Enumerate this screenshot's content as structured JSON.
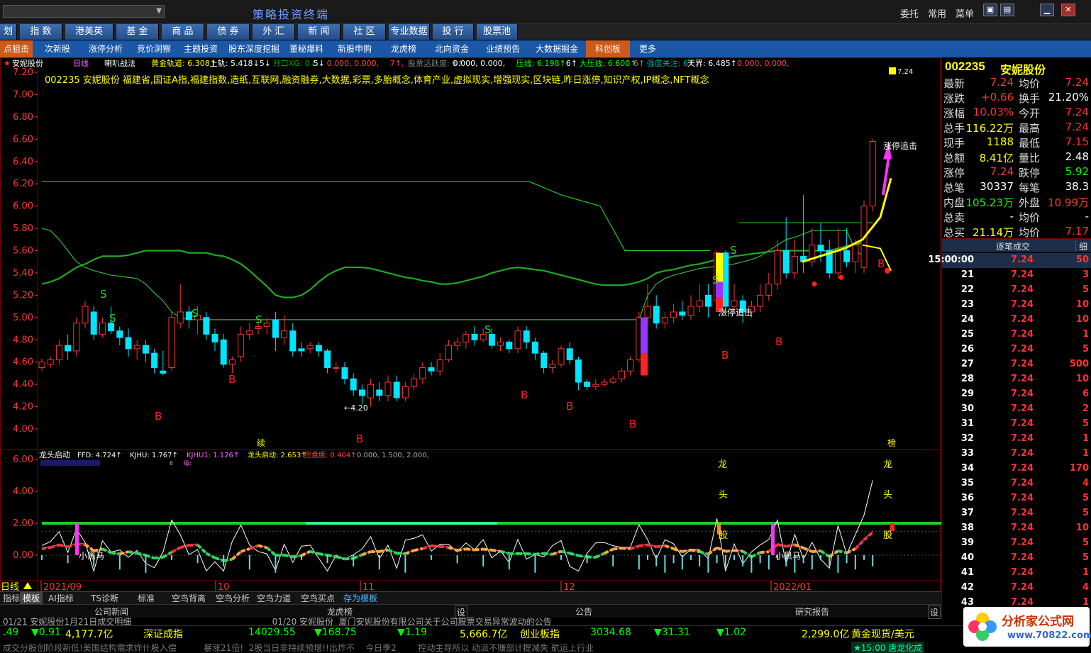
{
  "top": {
    "title": "策略投资终端",
    "links": [
      "委托",
      "常用",
      "菜单"
    ],
    "window_btns": [
      "▣",
      "▤",
      "▁",
      "✕"
    ]
  },
  "menu1": [
    "划板",
    "指 数",
    "港美英",
    "基 金",
    "商 品",
    "债 券",
    "外 汇",
    "新 闻",
    "社 区",
    "专业数据",
    "投 行",
    "股票池"
  ],
  "menu2": [
    "点狙击",
    "次新股",
    "涨停分析",
    "竞价洞察",
    "主题投资",
    "股东深度挖掘",
    "董秘爆料",
    "新股申购",
    "龙虎榜",
    "北向资金",
    "业绩预告",
    "大数据掘金",
    "科创板",
    "更多"
  ],
  "menu2_highlight": [
    0,
    12
  ],
  "chart": {
    "header": {
      "code_name": "安妮股份",
      "period": "日线",
      "indicator": "喇叭战法",
      "items": [
        {
          "t": "黄金轨道: 6.308↑",
          "c": "#ffff00"
        },
        {
          "t": "上轨: 5.418↓",
          "c": "#ffffff"
        },
        {
          "t": "5↓",
          "c": "#ffffff"
        },
        {
          "t": "开口XG: 0↓",
          "c": "#00aa00"
        },
        {
          "t": "5↓",
          "c": "#ffffff"
        },
        {
          "t": "0.000, 0.000,",
          "c": "#ff4444"
        },
        {
          "t": "7↑,",
          "c": "#ff4444"
        },
        {
          "t": "股票活跃度: 6↑",
          "c": "#888888"
        },
        {
          "t": "0.000, 0.000,",
          "c": "#ffffff"
        },
        {
          "t": "压线: 6.198↑",
          "c": "#00ff00"
        },
        {
          "t": "6↑",
          "c": "#ffffff"
        },
        {
          "t": "大压线: 6.600↑",
          "c": "#00ff00"
        },
        {
          "t": "6↑",
          "c": "#888888"
        },
        {
          "t": "强度关注: 6↑",
          "c": "#00aaaa"
        },
        {
          "t": "天界: 6.485↑",
          "c": "#ffffff"
        },
        {
          "t": "0.000, 0.000,",
          "c": "#ff4444"
        }
      ]
    },
    "concepts": "002235 安妮股份 福建省,国证A指,福建指数,造纸,互联网,融资融券,大数据,彩票,多胎概念,体育产业,虚拟现实,增强现实,区块链,昨日涨停,知识产权,IP概念,NFT概念",
    "price_ticks": [
      "7.20",
      "7.00",
      "6.80",
      "6.60",
      "6.40",
      "6.20",
      "6.00",
      "5.80",
      "5.60",
      "5.40",
      "5.20",
      "5.00",
      "4.80",
      "4.60",
      "4.40",
      "4.20",
      "4.00"
    ],
    "low_label": "←4.20",
    "tag_top": "7.24",
    "labels": {
      "zhangting": "涨停追击",
      "s": "S",
      "b": "B",
      "xu": "续",
      "bang": "榜",
      "long": "龙",
      "tou": "头",
      "gu": "股",
      "xiaoheima": "小黑马"
    },
    "sub": {
      "title": "龙头启动",
      "items": [
        {
          "t": "FFD: 4.724↑",
          "c": "#ffffff"
        },
        {
          "t": "KJHU: 1.767↑",
          "c": "#ffffff"
        },
        {
          "t": "KJHU1: 1.126↑",
          "c": "#ff66ff"
        },
        {
          "t": "龙头启动: 2.653↑",
          "c": "#ffff00"
        },
        {
          "t": "控盘度: 0.404↑",
          "c": "#ff4444"
        },
        {
          "t": "0.000, 1.500, 2.000,",
          "c": "#aaaaaa"
        }
      ],
      "line2": "6",
      "line2b": "6",
      "line2c": "级:",
      "ticks": [
        "6.00",
        "4.00",
        "2.00",
        "0.00"
      ]
    },
    "dates": [
      "2021/09",
      "10",
      "11",
      "12",
      "2022/01"
    ],
    "period_label": "日线"
  },
  "chart_data": {
    "type": "candlestick",
    "ylim": [
      3.9,
      7.3
    ],
    "candles": [
      [
        4.55,
        4.6,
        4.52,
        4.63
      ],
      [
        4.58,
        4.62,
        4.55,
        4.65
      ],
      [
        4.62,
        4.75,
        4.58,
        4.8
      ],
      [
        4.75,
        4.7,
        4.62,
        4.85
      ],
      [
        4.7,
        4.95,
        4.65,
        5.0
      ],
      [
        4.95,
        5.1,
        4.9,
        5.15
      ],
      [
        5.05,
        4.85,
        4.8,
        5.1
      ],
      [
        4.85,
        4.95,
        4.82,
        5.0
      ],
      [
        4.95,
        4.88,
        4.85,
        5.1
      ],
      [
        4.88,
        4.82,
        4.75,
        4.92
      ],
      [
        4.82,
        4.72,
        4.65,
        4.9
      ],
      [
        4.72,
        4.75,
        4.62,
        4.8
      ],
      [
        4.75,
        4.68,
        4.6,
        4.8
      ],
      [
        4.68,
        4.55,
        4.5,
        4.72
      ],
      [
        4.52,
        4.5,
        4.48,
        4.7
      ],
      [
        4.55,
        5.0,
        4.52,
        5.05
      ],
      [
        4.95,
        5.05,
        4.9,
        5.3
      ],
      [
        5.05,
        4.98,
        4.9,
        5.1
      ],
      [
        4.98,
        5.02,
        4.85,
        5.1
      ],
      [
        5.0,
        4.85,
        4.8,
        5.05
      ],
      [
        4.85,
        4.78,
        4.7,
        4.9
      ],
      [
        4.8,
        4.58,
        4.55,
        4.85
      ],
      [
        4.58,
        4.62,
        4.5,
        4.65
      ],
      [
        4.65,
        4.85,
        4.6,
        4.92
      ],
      [
        4.85,
        4.88,
        4.8,
        4.95
      ],
      [
        4.9,
        4.92,
        4.85,
        4.98
      ],
      [
        4.92,
        4.95,
        4.85,
        5.0
      ],
      [
        4.98,
        4.82,
        4.7,
        5.05
      ],
      [
        4.82,
        4.88,
        4.75,
        5.02
      ],
      [
        4.88,
        4.7,
        4.65,
        4.95
      ],
      [
        4.72,
        4.7,
        4.65,
        4.78
      ],
      [
        4.72,
        4.75,
        4.68,
        4.78
      ],
      [
        4.75,
        4.7,
        4.65,
        4.78
      ],
      [
        4.7,
        4.55,
        4.5,
        4.72
      ],
      [
        4.55,
        4.55,
        4.5,
        4.6
      ],
      [
        4.55,
        4.45,
        4.4,
        4.6
      ],
      [
        4.45,
        4.35,
        4.3,
        4.5
      ],
      [
        4.35,
        4.3,
        4.22,
        4.4
      ],
      [
        4.28,
        4.4,
        4.2,
        4.45
      ],
      [
        4.35,
        4.3,
        4.25,
        4.42
      ],
      [
        4.3,
        4.42,
        4.25,
        4.48
      ],
      [
        4.42,
        4.28,
        4.25,
        4.48
      ],
      [
        4.28,
        4.38,
        4.25,
        4.42
      ],
      [
        4.38,
        4.45,
        4.35,
        4.5
      ],
      [
        4.45,
        4.55,
        4.4,
        4.6
      ],
      [
        4.55,
        4.52,
        4.48,
        4.6
      ],
      [
        4.52,
        4.62,
        4.48,
        4.68
      ],
      [
        4.62,
        4.75,
        4.6,
        4.8
      ],
      [
        4.75,
        4.78,
        4.7,
        4.82
      ],
      [
        4.78,
        4.85,
        4.72,
        4.88
      ],
      [
        4.85,
        4.8,
        4.75,
        4.92
      ],
      [
        4.8,
        4.85,
        4.78,
        4.9
      ],
      [
        4.85,
        4.75,
        4.72,
        4.9
      ],
      [
        4.75,
        4.78,
        4.7,
        4.82
      ],
      [
        4.78,
        4.72,
        4.68,
        4.8
      ],
      [
        4.72,
        4.88,
        4.68,
        4.92
      ],
      [
        4.88,
        4.78,
        4.72,
        4.92
      ],
      [
        4.78,
        4.68,
        4.62,
        4.82
      ],
      [
        4.68,
        4.55,
        4.5,
        4.7
      ],
      [
        4.55,
        4.58,
        4.5,
        4.62
      ],
      [
        4.58,
        4.72,
        4.55,
        4.75
      ],
      [
        4.72,
        4.62,
        4.58,
        4.78
      ],
      [
        4.62,
        4.42,
        4.35,
        4.65
      ],
      [
        4.42,
        4.38,
        4.35,
        4.45
      ],
      [
        4.38,
        4.4,
        4.35,
        4.45
      ],
      [
        4.4,
        4.42,
        4.38,
        4.45
      ],
      [
        4.42,
        4.45,
        4.4,
        4.48
      ],
      [
        4.45,
        4.52,
        4.42,
        4.55
      ],
      [
        4.52,
        4.62,
        4.48,
        4.65
      ],
      [
        4.62,
        5.0,
        4.6,
        5.05
      ],
      [
        5.0,
        5.1,
        4.95,
        5.3
      ],
      [
        5.1,
        4.95,
        4.9,
        5.2
      ],
      [
        4.95,
        5.0,
        4.9,
        5.05
      ],
      [
        5.0,
        5.05,
        4.95,
        5.12
      ],
      [
        5.05,
        5.02,
        4.98,
        5.15
      ],
      [
        5.02,
        5.1,
        4.98,
        5.2
      ],
      [
        5.1,
        5.15,
        5.05,
        5.3
      ],
      [
        5.2,
        5.1,
        5.0,
        5.3
      ],
      [
        5.15,
        5.58,
        5.1,
        5.6
      ],
      [
        5.58,
        5.1,
        5.05,
        5.6
      ],
      [
        5.1,
        5.15,
        5.05,
        5.3
      ],
      [
        5.15,
        5.05,
        4.95,
        5.2
      ],
      [
        5.05,
        5.1,
        5.0,
        5.15
      ],
      [
        5.1,
        5.2,
        5.05,
        5.3
      ],
      [
        5.2,
        5.3,
        5.15,
        5.4
      ],
      [
        5.3,
        5.6,
        5.25,
        5.7
      ],
      [
        5.6,
        5.4,
        5.35,
        5.9
      ],
      [
        5.4,
        5.55,
        5.35,
        5.7
      ],
      [
        5.55,
        5.5,
        5.4,
        6.1
      ],
      [
        5.5,
        5.65,
        5.45,
        5.8
      ],
      [
        5.65,
        5.6,
        5.5,
        5.85
      ],
      [
        5.6,
        5.4,
        5.35,
        5.7
      ],
      [
        5.4,
        5.6,
        5.35,
        5.8
      ],
      [
        5.6,
        5.5,
        5.45,
        5.8
      ],
      [
        5.5,
        5.65,
        5.4,
        5.7
      ],
      [
        5.45,
        6.0,
        5.4,
        6.05
      ],
      [
        6.0,
        6.58,
        5.95,
        6.6
      ]
    ],
    "ma_green": [
      5.8,
      5.78,
      5.7,
      5.6,
      5.5,
      5.45,
      5.42,
      5.4,
      5.38,
      5.37,
      5.36,
      5.35,
      5.3,
      5.22,
      5.15,
      5.05,
      5.0,
      4.98,
      4.98,
      4.98,
      4.98,
      4.98,
      4.98,
      4.98,
      4.98,
      4.98,
      4.98,
      4.98,
      4.98,
      4.98,
      4.98,
      4.98,
      4.98,
      4.98,
      4.98,
      4.98,
      4.98,
      4.98,
      4.98,
      4.98,
      4.98,
      4.98,
      4.98,
      4.98,
      4.98,
      4.98,
      4.98,
      4.98,
      4.98,
      4.98,
      4.98,
      4.98,
      4.98,
      4.98,
      4.98,
      4.98,
      4.98,
      4.98,
      4.98,
      4.98,
      4.98,
      4.98,
      4.98,
      4.98,
      4.98,
      4.98,
      4.98,
      4.98,
      4.98,
      4.98,
      5.2,
      5.3,
      5.35,
      5.38,
      5.4,
      5.42,
      5.44,
      5.45,
      5.46,
      5.47,
      5.48,
      5.5,
      5.52,
      5.55,
      5.6,
      5.65,
      5.7,
      5.72,
      5.75,
      5.78,
      5.78,
      5.78,
      5.78,
      5.78,
      5.6,
      5.55
    ],
    "trail_green": [
      5.3,
      5.32,
      5.35,
      5.4,
      5.45,
      5.48,
      5.52,
      5.55,
      5.55,
      5.55,
      5.56,
      5.58,
      5.6,
      5.6,
      5.6,
      5.6,
      5.6,
      5.58,
      5.58,
      5.58,
      5.56,
      5.55,
      5.52,
      5.48,
      5.42,
      5.35,
      5.28,
      5.2,
      5.18,
      5.18,
      5.2,
      5.25,
      5.32,
      5.38,
      5.42,
      5.45,
      5.45,
      5.45,
      5.44,
      5.42,
      5.4,
      5.38,
      5.36,
      5.35,
      5.33,
      5.32,
      5.3,
      5.3,
      5.31,
      5.33,
      5.35,
      5.37,
      5.4,
      5.42,
      5.44,
      5.45,
      5.44,
      5.43,
      5.42,
      5.4,
      5.38,
      5.36,
      5.34,
      5.32,
      5.3,
      5.29,
      5.29,
      5.29,
      5.3,
      5.32,
      5.35,
      5.4,
      5.42,
      5.43,
      5.45,
      5.47,
      5.48,
      5.5,
      5.52,
      5.53,
      5.55,
      5.56,
      5.57,
      5.58,
      5.59,
      5.6,
      5.6,
      5.6,
      5.6,
      5.6,
      5.6,
      5.6,
      5.62,
      5.64,
      5.65,
      5.68
    ],
    "upper_green": 6.22,
    "upper_drop_index": 66,
    "flat_green": 4.98
  },
  "quote": {
    "code": "002235",
    "name": "安妮股份",
    "rows": [
      [
        "最新",
        "7.24",
        "#ff3333",
        "均价",
        "7.24",
        "#ff3333"
      ],
      [
        "涨跌",
        "+0.66",
        "#ff3333",
        "换手",
        "21.20%",
        "#ffffff"
      ],
      [
        "涨幅",
        "10.03%",
        "#ff3333",
        "今开",
        "7.24",
        "#ff3333"
      ],
      [
        "总手",
        "116.22万",
        "#ffff00",
        "最高",
        "7.24",
        "#ff3333"
      ],
      [
        "现手",
        "1188",
        "#ffff00",
        "最低",
        "7.15",
        "#ff3333"
      ],
      [
        "总额",
        "8.41亿",
        "#ffff00",
        "量比",
        "2.48",
        "#ffffff"
      ],
      [
        "涨停",
        "7.24",
        "#ff3333",
        "跌停",
        "5.92",
        "#00ff00"
      ],
      [
        "总笔",
        "30337",
        "#ffffff",
        "每笔",
        "38.3",
        "#ffffff"
      ],
      [
        "内盘",
        "105.23万",
        "#00ff00",
        "外盘",
        "10.99万",
        "#ff3333"
      ],
      [
        "总卖",
        "-",
        "#ffffff",
        "均价",
        "-",
        "#ffffff"
      ],
      [
        "总买",
        "21.14万",
        "#ffff00",
        "均价",
        "7.17",
        "#ff3333"
      ]
    ],
    "ticks_header": "逐笔成交",
    "ticks_detail": "细",
    "ticks": [
      [
        "15:00:00",
        "7.24",
        "50"
      ],
      [
        "21",
        "7.24",
        "3"
      ],
      [
        "22",
        "7.24",
        "5"
      ],
      [
        "23",
        "7.24",
        "10"
      ],
      [
        "24",
        "7.24",
        "10"
      ],
      [
        "25",
        "7.24",
        "1"
      ],
      [
        "26",
        "7.24",
        "5"
      ],
      [
        "27",
        "7.24",
        "500"
      ],
      [
        "28",
        "7.24",
        "10"
      ],
      [
        "29",
        "7.24",
        "6"
      ],
      [
        "30",
        "7.24",
        "2"
      ],
      [
        "31",
        "7.24",
        "5"
      ],
      [
        "32",
        "7.24",
        "1"
      ],
      [
        "33",
        "7.24",
        "1"
      ],
      [
        "34",
        "7.24",
        "170"
      ],
      [
        "35",
        "7.24",
        "4"
      ],
      [
        "36",
        "7.24",
        "5"
      ],
      [
        "37",
        "7.24",
        "5"
      ],
      [
        "38",
        "7.24",
        "10"
      ],
      [
        "39",
        "7.24",
        "5"
      ],
      [
        "40",
        "7.24",
        "5"
      ],
      [
        "41",
        "7.24",
        "1"
      ],
      [
        "42",
        "7.24",
        "4"
      ],
      [
        "43",
        "7.24",
        "1"
      ]
    ]
  },
  "tabs": [
    "指标",
    "模板",
    "AI指标",
    "TS诊断",
    "标准",
    "空鸟背离",
    "空鸟分析",
    "空鸟力道",
    "空鸟买点",
    "存为模板"
  ],
  "news_headers": [
    "公司新闻",
    "龙虎榜",
    "设",
    "公告",
    "研究报告",
    "设"
  ],
  "news_row": "01/21 安妮股份1月21日成交明细                                                    01/20 安妮股份  厦门安妮股份有限公司关于公司股票交易异常波动的公告",
  "status": [
    {
      "t": ".49",
      "c": "#00ff00"
    },
    {
      "t": "▼0.91",
      "c": "#00ff00"
    },
    {
      "t": "4,177.7亿",
      "c": "#ffff00"
    },
    {
      "t": "深证成指",
      "c": "#ffff00"
    },
    {
      "t": "14029.55",
      "c": "#00ff00"
    },
    {
      "t": "▼168.75",
      "c": "#00ff00"
    },
    {
      "t": "▼1.19",
      "c": "#00ff00"
    },
    {
      "t": "5,666.7亿",
      "c": "#ffff00"
    },
    {
      "t": "创业板指",
      "c": "#ffff00"
    },
    {
      "t": "3034.68",
      "c": "#00ff00"
    },
    {
      "t": "▼31.31",
      "c": "#00ff00"
    },
    {
      "t": "▼1.02",
      "c": "#00ff00"
    },
    {
      "t": "2,299.0亿",
      "c": "#ffff00"
    },
    {
      "t": "黄金现货/美元",
      "c": "#ffff00"
    }
  ],
  "scroll_text": "成交分股创阶段新低!美国结构需求炸什股入偿          暴涨21倍!  2股当日非持续预增!!出炸不    今日季2        控动主导所以 动派不赚部计提减失 航运上行业",
  "scroll_time": "★15:00 唐龙化成",
  "logo": {
    "t1": "分析家公式网",
    "t2": "www.70822.com"
  }
}
